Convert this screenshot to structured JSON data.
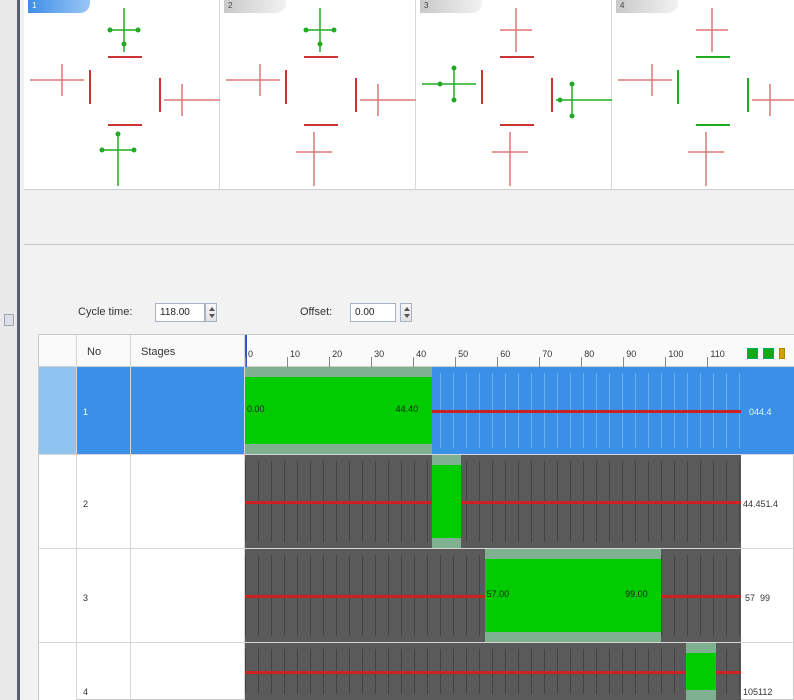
{
  "stage_tabs": [
    "1",
    "2",
    "3",
    "4"
  ],
  "cycle": {
    "label": "Cycle time:",
    "value": "118.00"
  },
  "offset": {
    "label": "Offset:",
    "value": "0.00"
  },
  "columns": {
    "no": "No",
    "stages": "Stages"
  },
  "ruler_ticks": [
    "0",
    "10",
    "20",
    "30",
    "40",
    "50",
    "60",
    "70",
    "80",
    "90",
    "100",
    "110"
  ],
  "rows": [
    {
      "no": "1",
      "start_label": "0.00",
      "end_label": "44.40",
      "tail": "044.4",
      "start": 0,
      "end": 44.4,
      "selected": true
    },
    {
      "no": "2",
      "start_label": "",
      "end_label": "",
      "tail": "44.451.4",
      "start": 44.4,
      "end": 51.4,
      "selected": false
    },
    {
      "no": "3",
      "start_label": "57.00",
      "end_label": "99.00",
      "tail": "57  99",
      "start": 57,
      "end": 99,
      "selected": false
    },
    {
      "no": "4",
      "start_label": "",
      "end_label": "",
      "tail": "105112",
      "start": 105,
      "end": 112,
      "selected": false
    }
  ],
  "colors": {
    "green": "#00cc00",
    "red_line": "#cc2222",
    "blue_sel": "#3a8fe6",
    "gray_track": "#5a5a5a"
  },
  "axis_max": 118
}
